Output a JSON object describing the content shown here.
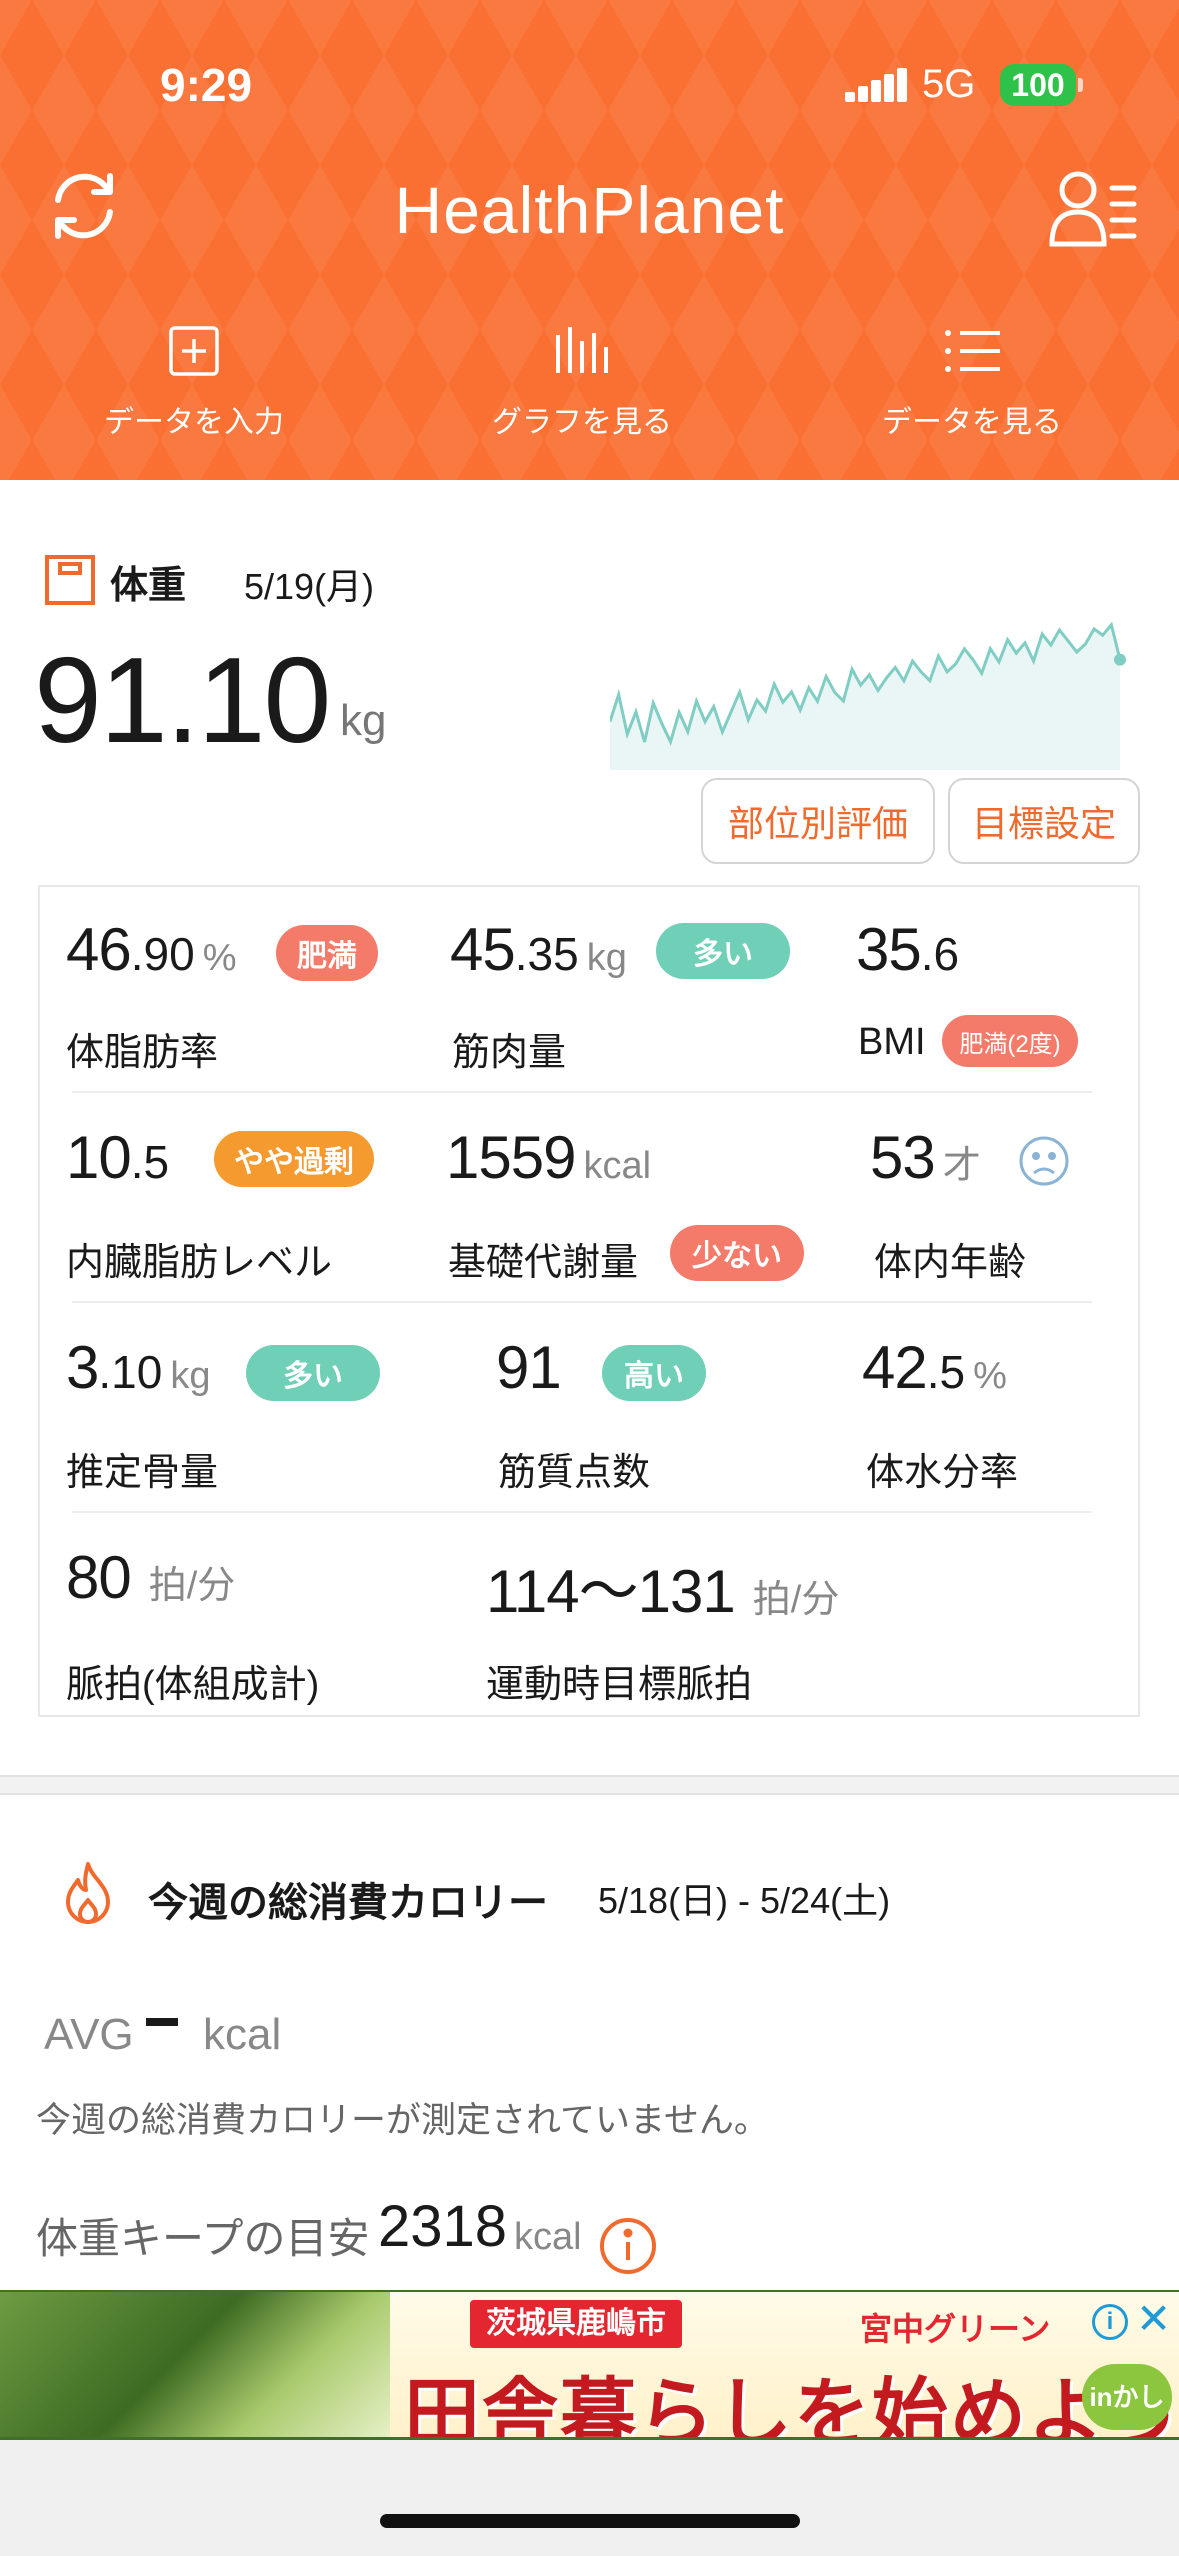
{
  "status_bar": {
    "time": "9:29",
    "network": "5G",
    "battery": "100"
  },
  "header": {
    "logo": "HealthPlanet",
    "nav": [
      {
        "label": "データを入力",
        "icon": "plus-square-icon"
      },
      {
        "label": "グラフを見る",
        "icon": "bar-graph-icon"
      },
      {
        "label": "データを見る",
        "icon": "list-icon"
      }
    ]
  },
  "weight": {
    "title": "体重",
    "date": "5/19(月)",
    "value": "91.10",
    "unit": "kg",
    "button_part_eval": "部位別評価",
    "button_goal": "目標設定",
    "trend": [
      40,
      18,
      52,
      34,
      60,
      28,
      46,
      62,
      38,
      55,
      30,
      48,
      36,
      58,
      42,
      26,
      50,
      34,
      44,
      22,
      38,
      30,
      46,
      28,
      40,
      20,
      34,
      42,
      16,
      30,
      22,
      36,
      26,
      18,
      30,
      14,
      24,
      32,
      12,
      26,
      20,
      8,
      18,
      30,
      10,
      22,
      4,
      16,
      8,
      24,
      2,
      12,
      0,
      10,
      20,
      14,
      2,
      8,
      0,
      30
    ]
  },
  "metrics": {
    "body_fat": {
      "int": "46",
      "dec": ".90",
      "unit": "%",
      "badge": "肥満",
      "label": "体脂肪率"
    },
    "muscle": {
      "int": "45",
      "dec": ".35",
      "unit": "kg",
      "badge": "多い",
      "label": "筋肉量"
    },
    "bmi": {
      "int": "35",
      "dec": ".6",
      "badge": "肥満(2度)",
      "label": "BMI"
    },
    "visceral": {
      "int": "10",
      "dec": ".5",
      "badge": "やや過剰",
      "label": "内臓脂肪レベル"
    },
    "bmr": {
      "int": "1559",
      "unit": "kcal",
      "badge": "少ない",
      "label": "基礎代謝量"
    },
    "body_age": {
      "int": "53",
      "unit": "才",
      "label": "体内年齢"
    },
    "bone": {
      "int": "3",
      "dec": ".10",
      "unit": "kg",
      "badge": "多い",
      "label": "推定骨量"
    },
    "muscle_score": {
      "int": "91",
      "badge": "高い",
      "label": "筋質点数"
    },
    "water": {
      "int": "42",
      "dec": ".5",
      "unit": "%",
      "label": "体水分率"
    },
    "pulse": {
      "int": "80",
      "unit": "拍/分",
      "label": "脈拍(体組成計)"
    },
    "target_pulse": {
      "int": "114〜131",
      "unit": "拍/分",
      "label": "運動時目標脈拍"
    }
  },
  "calories": {
    "title": "今週の総消費カロリー",
    "range": "5/18(日) - 5/24(土)",
    "avg_label": "AVG",
    "avg_unit": "kcal",
    "note": "今週の総消費カロリーが測定されていません。",
    "keep_label": "体重キープの目安",
    "keep_value": "2318",
    "keep_unit": "kcal"
  },
  "ad": {
    "prefecture": "茨城県鹿嶋市",
    "brand": "宮中グリーン",
    "headline": "田舎暮らしを始めよう!",
    "badge": "inかしま"
  },
  "colors": {
    "brand": "#fa6f32",
    "accent_text": "#f06a2e",
    "badge_red": "#f47a6a",
    "badge_teal": "#6fcfb7",
    "badge_orange": "#f49a2f",
    "chart_line": "#7fcdc3"
  }
}
